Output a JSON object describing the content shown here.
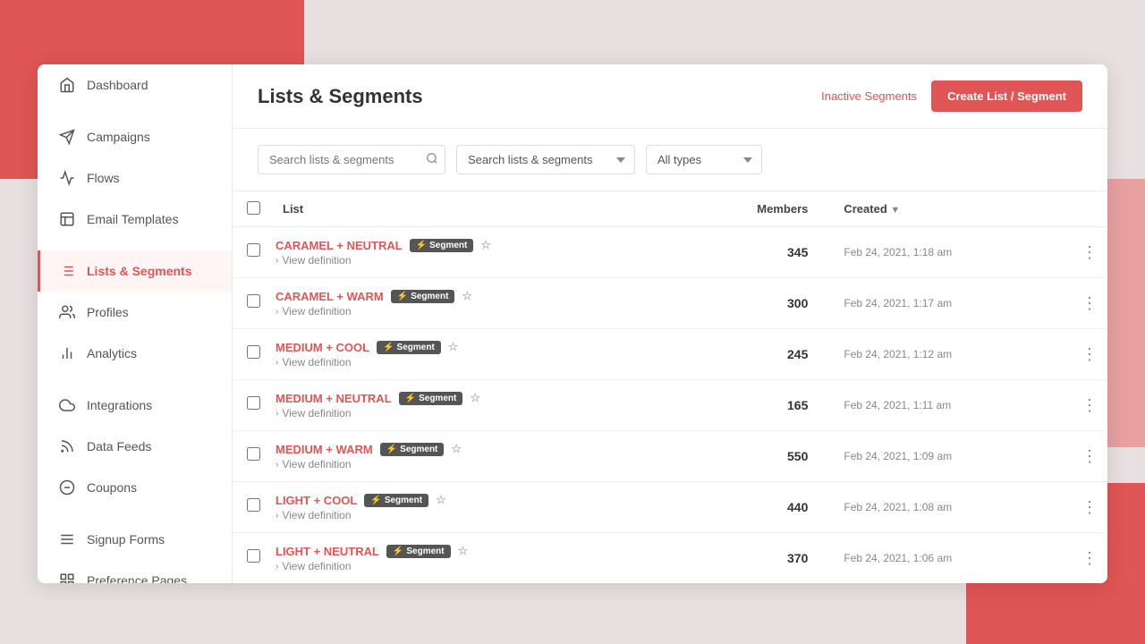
{
  "page": {
    "title": "Lists & Segments",
    "inactive_segments_label": "Inactive Segments",
    "create_btn_label": "Create List / Segment"
  },
  "sidebar": {
    "items": [
      {
        "id": "dashboard",
        "label": "Dashboard",
        "icon": "home",
        "active": false
      },
      {
        "id": "campaigns",
        "label": "Campaigns",
        "icon": "paper-plane",
        "active": false
      },
      {
        "id": "flows",
        "label": "Flows",
        "icon": "flow",
        "active": false
      },
      {
        "id": "email-templates",
        "label": "Email Templates",
        "icon": "template",
        "active": false
      },
      {
        "id": "lists-segments",
        "label": "Lists & Segments",
        "icon": "list",
        "active": true
      },
      {
        "id": "profiles",
        "label": "Profiles",
        "icon": "profile",
        "active": false
      },
      {
        "id": "analytics",
        "label": "Analytics",
        "icon": "analytics",
        "active": false
      },
      {
        "id": "integrations",
        "label": "Integrations",
        "icon": "cloud",
        "active": false
      },
      {
        "id": "data-feeds",
        "label": "Data Feeds",
        "icon": "feed",
        "active": false
      },
      {
        "id": "coupons",
        "label": "Coupons",
        "icon": "coupon",
        "active": false
      },
      {
        "id": "signup-forms",
        "label": "Signup Forms",
        "icon": "signup",
        "active": false
      },
      {
        "id": "preference-pages",
        "label": "Preference Pages",
        "icon": "preference",
        "active": false
      }
    ]
  },
  "filters": {
    "search_placeholder": "Search lists & segments",
    "dropdown_placeholder": "Search lists & segments",
    "type_options": [
      "All types"
    ],
    "type_selected": "All types"
  },
  "table": {
    "col_list": "List",
    "col_members": "Members",
    "col_created": "Created",
    "rows": [
      {
        "name": "CARAMEL + NEUTRAL",
        "badge": "Segment",
        "members": "345",
        "created": "Feb 24, 2021, 1:18 am"
      },
      {
        "name": "CARAMEL + WARM",
        "badge": "Segment",
        "members": "300",
        "created": "Feb 24, 2021, 1:17 am"
      },
      {
        "name": "MEDIUM + COOL",
        "badge": "Segment",
        "members": "245",
        "created": "Feb 24, 2021, 1:12 am"
      },
      {
        "name": "MEDIUM + NEUTRAL",
        "badge": "Segment",
        "members": "165",
        "created": "Feb 24, 2021, 1:11 am"
      },
      {
        "name": "MEDIUM + WARM",
        "badge": "Segment",
        "members": "550",
        "created": "Feb 24, 2021, 1:09 am"
      },
      {
        "name": "LIGHT + COOL",
        "badge": "Segment",
        "members": "440",
        "created": "Feb 24, 2021, 1:08 am"
      },
      {
        "name": "LIGHT + NEUTRAL",
        "badge": "Segment",
        "members": "370",
        "created": "Feb 24, 2021, 1:06 am"
      }
    ],
    "view_definition_label": "View definition"
  }
}
